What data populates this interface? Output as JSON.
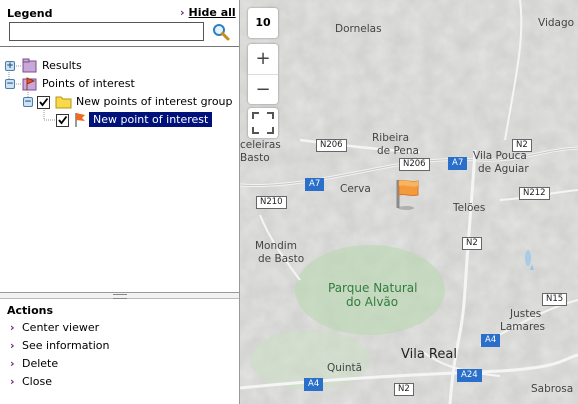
{
  "legend": {
    "title": "Legend",
    "hide_all": "Hide all",
    "search_value": "",
    "tree": [
      {
        "label": "Results"
      },
      {
        "label": "Points of interest"
      },
      {
        "label": "New points of interest group"
      },
      {
        "label": "New point of interest"
      }
    ]
  },
  "actions": {
    "title": "Actions",
    "items": [
      "Center viewer",
      "See information",
      "Delete",
      "Close"
    ]
  },
  "map": {
    "zoom_level": "10",
    "zoom_in": "+",
    "zoom_out": "−",
    "places": {
      "dornelas": "Dornelas",
      "vidago": "Vidago",
      "ribeira": "Ribeira",
      "de_pena": "de Pena",
      "vila_pouca": "Vila Pouca",
      "de_aguiar": "de Aguiar",
      "celeiras": "celeiras",
      "basto": "Basto",
      "cerva": "Cerva",
      "teloes": "Telões",
      "mondim": "Mondim",
      "de_basto": "de Basto",
      "parque": "Parque Natural",
      "do_alvao": "do Alvão",
      "justes": "Justes",
      "lamares": "Lamares",
      "vila_real": "Vila Real",
      "quinta": "Quintã",
      "sabrosa": "Sabrosa"
    },
    "roads": {
      "n206a": "N206",
      "n206b": "N206",
      "a7a": "A7",
      "a7b": "A7",
      "n2a": "N2",
      "n2b": "N2",
      "n2c": "N2",
      "n212": "N212",
      "n210": "N210",
      "n15": "N15",
      "a4a": "A4",
      "a4b": "A4",
      "a24": "A24"
    }
  }
}
